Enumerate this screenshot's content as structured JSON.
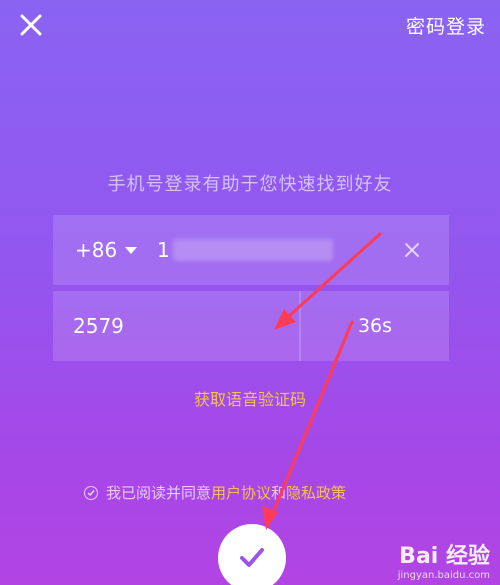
{
  "header": {
    "close_icon": "close-icon",
    "password_login_label": "密码登录"
  },
  "hint": "手机号登录有助于您快速找到好友",
  "phone_row": {
    "country_code": "+86",
    "phone_value": "1",
    "clear_icon": "clear-icon"
  },
  "code_row": {
    "code_value": "2579",
    "countdown": "36s"
  },
  "voice_code_label": "获取语音验证码",
  "agreement": {
    "prefix": "我已阅读并同意",
    "user_agreement": "用户协议",
    "and": "和",
    "privacy_policy": "隐私政策"
  },
  "confirm_icon": "checkmark-icon",
  "watermark": {
    "brand": "Bai 经验",
    "domain": "jingyan.baidu.com"
  },
  "colors": {
    "accent_link": "#f6c14c",
    "annotation_arrow": "#ff3b55",
    "confirm_check": "#9d52ec"
  }
}
